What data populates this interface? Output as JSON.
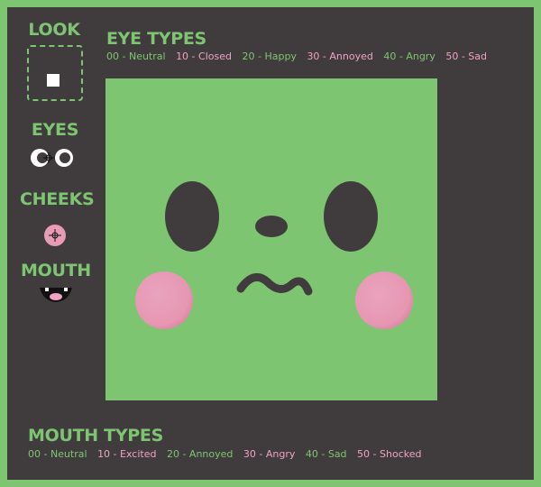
{
  "sidebar": {
    "look_label": "LOOK",
    "eyes_label": "EYES",
    "cheeks_label": "CHEEKS",
    "mouth_label": "MOUTH"
  },
  "eye_types": {
    "title": "EYE TYPES",
    "items": [
      "00 - Neutral",
      "10 - Closed",
      "20 - Happy",
      "30 - Annoyed",
      "40 - Angry",
      "50 - Sad"
    ]
  },
  "mouth_types": {
    "title": "MOUTH TYPES",
    "items": [
      "00 - Neutral",
      "10 - Excited",
      "20 - Annoyed",
      "30 - Angry",
      "40 - Sad",
      "50 - Shocked"
    ]
  },
  "colors": {
    "accent_green": "#7ec571",
    "accent_pink": "#f0a2c3",
    "panel_dark": "#403c3e",
    "cheek_pink": "#e79bb5"
  }
}
